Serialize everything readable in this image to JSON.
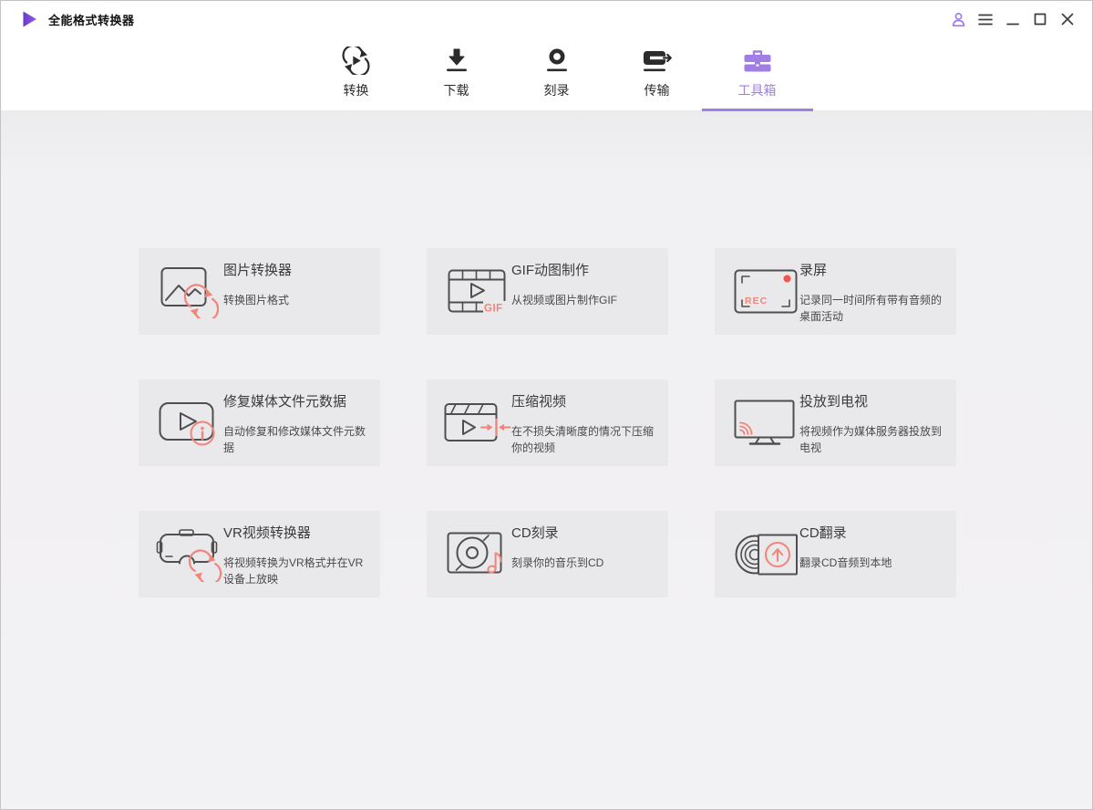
{
  "window": {
    "title": "全能格式转换器"
  },
  "nav": {
    "tabs": [
      {
        "label": "转换",
        "active": false
      },
      {
        "label": "下载",
        "active": false
      },
      {
        "label": "刻录",
        "active": false
      },
      {
        "label": "传输",
        "active": false
      },
      {
        "label": "工具箱",
        "active": true
      }
    ]
  },
  "cards": [
    {
      "title": "图片转换器",
      "subtitle": "转换图片格式"
    },
    {
      "title": "GIF动图制作",
      "subtitle": "从视频或图片制作GIF"
    },
    {
      "title": "录屏",
      "subtitle": "记录同一时间所有带有音频的桌面活动"
    },
    {
      "title": "修复媒体文件元数据",
      "subtitle": "自动修复和修改媒体文件元数据"
    },
    {
      "title": "压缩视频",
      "subtitle": "在不损失清晰度的情况下压缩你的视频"
    },
    {
      "title": "投放到电视",
      "subtitle": "将视频作为媒体服务器投放到电视"
    },
    {
      "title": "VR视频转换器",
      "subtitle": "将视频转换为VR格式并在VR设备上放映"
    },
    {
      "title": "CD刻录",
      "subtitle": "刻录你的音乐到CD"
    },
    {
      "title": "CD翻录",
      "subtitle": "翻录CD音频到本地"
    }
  ],
  "icon_text": {
    "rec": "REC",
    "gif": "GIF"
  },
  "colors": {
    "accent_purple": "#a07ee6",
    "salmon": "#f2857a",
    "record_red": "#f2564c",
    "logo_purple": "#7a4bd6"
  }
}
